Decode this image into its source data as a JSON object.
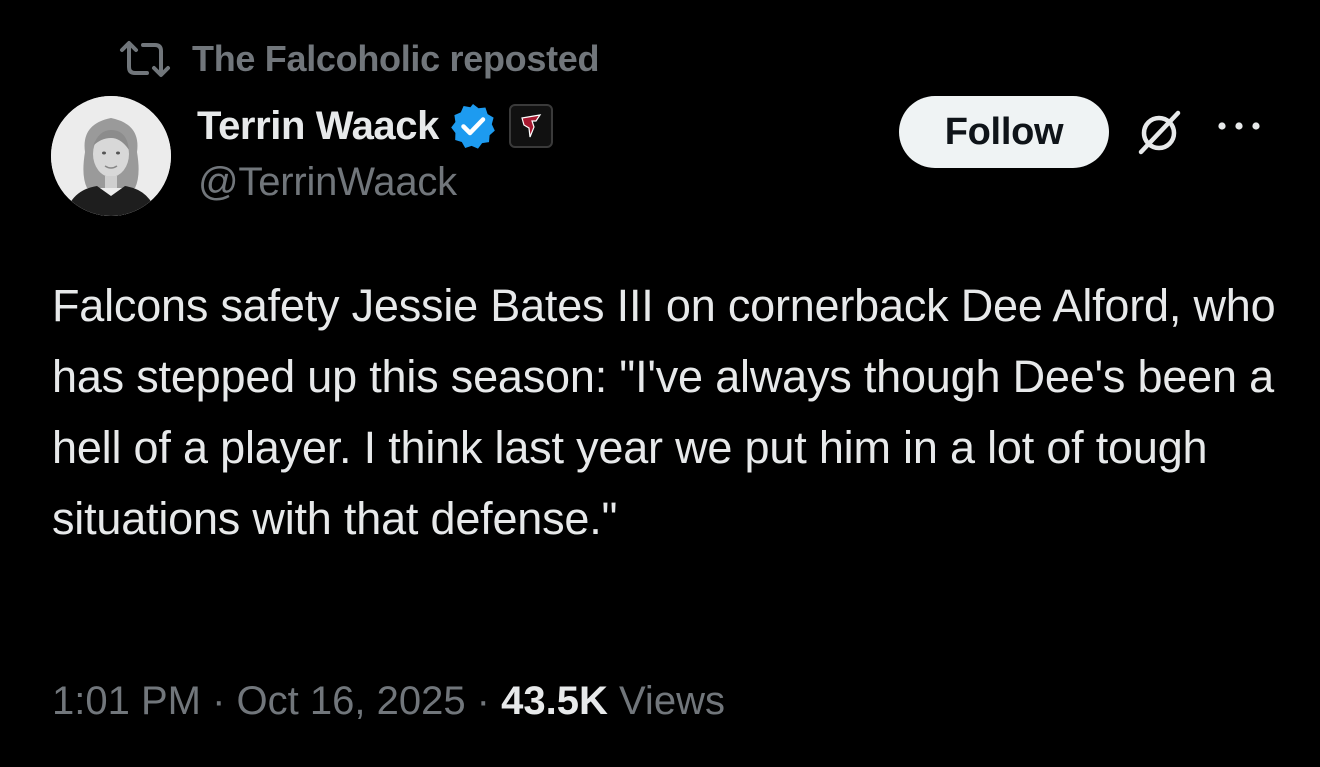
{
  "repost": {
    "icon": "repost-icon",
    "text": "The Falcoholic reposted"
  },
  "author": {
    "display_name": "Terrin Waack",
    "handle": "@TerrinWaack",
    "verified_icon": "verified-badge-icon",
    "affiliate_icon": "falcons-logo-icon",
    "avatar": "author-avatar"
  },
  "actions": {
    "follow_label": "Follow",
    "grok_icon": "grok-icon",
    "more_icon": "more-options-icon"
  },
  "tweet": {
    "text": "Falcons safety Jessie Bates III on cornerback Dee Alford, who has stepped up this season: \"I've always though Dee's been a hell of a player. I think last year we put him in a lot of tough situations with that defense.\""
  },
  "meta": {
    "time": "1:01 PM",
    "sep1": " · ",
    "date": "Oct 16, 2025",
    "sep2": " · ",
    "views_count": "43.5K",
    "views_label": " Views"
  },
  "colors": {
    "background": "#000000",
    "primary_text": "#e7e9ea",
    "secondary_text": "#71767b",
    "verified_blue": "#1d9bf0",
    "follow_bg": "#eff3f4"
  }
}
